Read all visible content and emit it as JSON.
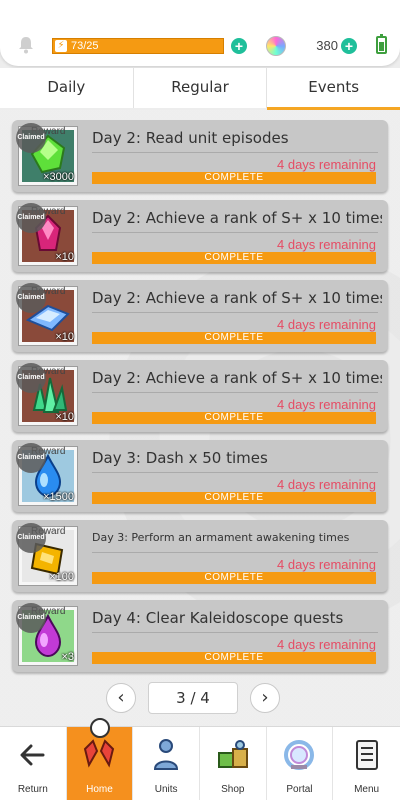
{
  "status": {
    "stamina": "73/25",
    "gems": "380",
    "bell_icon": "bell-icon",
    "orb_icon": "crystal-orb-icon",
    "battery_icon": "battery-icon"
  },
  "tabs": [
    {
      "label": "Daily",
      "active": false
    },
    {
      "label": "Regular",
      "active": false
    },
    {
      "label": "Events",
      "active": true
    }
  ],
  "common": {
    "reward_label": "Reward",
    "claimed": "Claimed",
    "complete": "COMPLETE"
  },
  "missions": [
    {
      "title": "Day 2: Read  unit episodes",
      "quantity": "×3000",
      "remaining": "4 days remaining",
      "item_icon": "green-crystal-icon",
      "progress": 1.0
    },
    {
      "title": "Day 2: Achieve a rank of S+  x 10 times",
      "quantity": "×10",
      "remaining": "4 days remaining",
      "item_icon": "red-gem-icon",
      "progress": 1.0
    },
    {
      "title": "Day 2: Achieve a rank of S+  x 10 times",
      "quantity": "×10",
      "remaining": "4 days remaining",
      "item_icon": "blue-shard-icon",
      "progress": 1.0
    },
    {
      "title": "Day 2: Achieve a rank of S+  x 10 times",
      "quantity": "×10",
      "remaining": "4 days remaining",
      "item_icon": "green-crystal-cluster-icon",
      "progress": 1.0
    },
    {
      "title": "Day 3: Dash  x 50 times",
      "quantity": "×1500",
      "remaining": "4 days remaining",
      "item_icon": "blue-drop-icon",
      "progress": 1.0
    },
    {
      "title": "Day 3: Perform an armament awakening  times",
      "quantity": "×100",
      "remaining": "4 days remaining",
      "item_icon": "gold-ticket-icon",
      "progress": 1.0
    },
    {
      "title": "Day 4: Clear  Kaleidoscope quests",
      "quantity": "×3",
      "remaining": "4 days remaining",
      "item_icon": "purple-gem-icon",
      "progress": 1.0
    }
  ],
  "pager": {
    "value": "3 / 4",
    "prev_icon": "chevron-left-icon",
    "next_icon": "chevron-right-icon"
  },
  "nav": [
    {
      "label": "Return",
      "icon": "arrow-left-icon",
      "active": false
    },
    {
      "label": "Home",
      "icon": "home-icon",
      "active": true
    },
    {
      "label": "Units",
      "icon": "units-icon",
      "active": false
    },
    {
      "label": "Shop",
      "icon": "shop-icon",
      "active": false
    },
    {
      "label": "Portal",
      "icon": "portal-icon",
      "active": false
    },
    {
      "label": "Menu",
      "icon": "menu-icon",
      "active": false
    }
  ],
  "colors": {
    "accent": "#f59a12",
    "remaining": "#e54c64",
    "plus": "#1fbf9a"
  }
}
